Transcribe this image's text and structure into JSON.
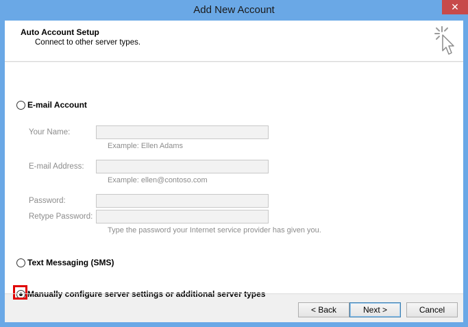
{
  "window": {
    "title": "Add New Account",
    "close_glyph": "✕"
  },
  "header": {
    "title": "Auto Account Setup",
    "subtitle": "Connect to other server types."
  },
  "options": {
    "email": {
      "label": "E-mail Account",
      "checked": false
    },
    "sms": {
      "label": "Text Messaging (SMS)",
      "checked": false
    },
    "manual": {
      "label": "Manually configure server settings or additional server types",
      "checked": true
    }
  },
  "fields": {
    "your_name": {
      "label": "Your Name:",
      "value": "",
      "example": "Example: Ellen Adams"
    },
    "email_address": {
      "label": "E-mail Address:",
      "value": "",
      "example": "Example: ellen@contoso.com"
    },
    "password": {
      "label": "Password:",
      "value": ""
    },
    "retype_password": {
      "label": "Retype Password:",
      "value": ""
    },
    "password_hint": "Type the password your Internet service provider has given you."
  },
  "buttons": {
    "back": "< Back",
    "next": "Next >",
    "cancel": "Cancel"
  },
  "colors": {
    "titlebar": "#6aa8e6",
    "close": "#c74a4a",
    "highlight": "#e00000"
  },
  "icons": {
    "header": "wizard-cursor-icon"
  }
}
